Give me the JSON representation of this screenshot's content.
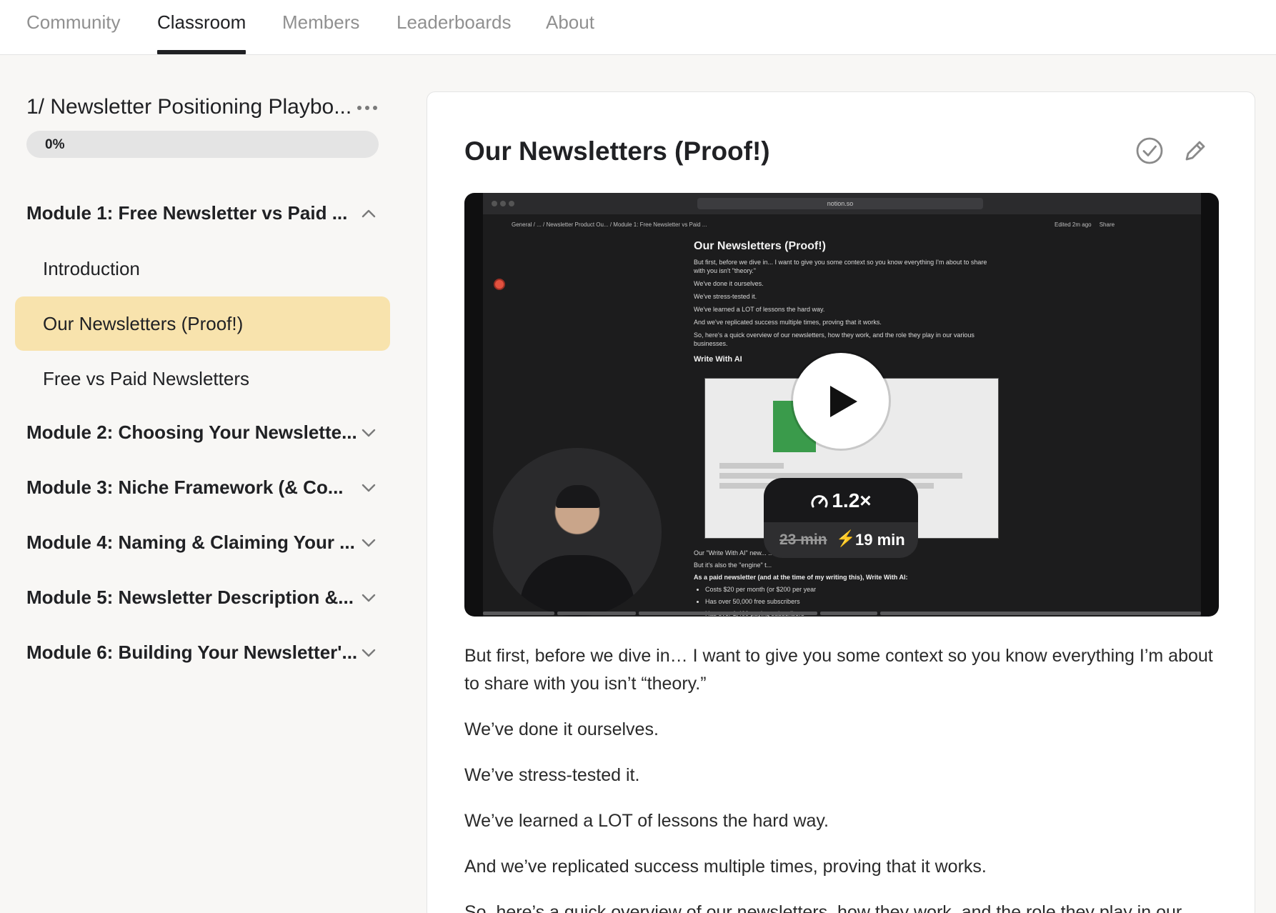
{
  "nav": {
    "tabs": [
      {
        "label": "Community",
        "active": false
      },
      {
        "label": "Classroom",
        "active": true
      },
      {
        "label": "Members",
        "active": false
      },
      {
        "label": "Leaderboards",
        "active": false
      },
      {
        "label": "About",
        "active": false
      }
    ]
  },
  "sidebar": {
    "course_title": "1/ Newsletter Positioning Playbo...",
    "progress": {
      "label": "0%",
      "value": 0
    },
    "modules": [
      {
        "label": "Module 1: Free Newsletter vs Paid ...",
        "expanded": true
      },
      {
        "label": "Module 2: Choosing Your Newslette...",
        "expanded": false
      },
      {
        "label": "Module 3: Niche Framework (& Co...",
        "expanded": false
      },
      {
        "label": "Module 4: Naming & Claiming Your ...",
        "expanded": false
      },
      {
        "label": "Module 5: Newsletter Description &...",
        "expanded": false
      },
      {
        "label": "Module 6: Building Your Newsletter'...",
        "expanded": false
      }
    ],
    "lessons": [
      {
        "label": "Introduction",
        "active": false
      },
      {
        "label": "Our Newsletters (Proof!)",
        "active": true
      },
      {
        "label": "Free vs Paid Newsletters",
        "active": false
      }
    ]
  },
  "lesson": {
    "title": "Our Newsletters (Proof!)",
    "video": {
      "url": "notion.so",
      "breadcrumbs": "General / ... / Newsletter Product Ou... / Module 1: Free Newsletter vs Paid ...",
      "edited": "Edited 2m ago",
      "share": "Share",
      "doc_title": "Our Newsletters (Proof!)",
      "doc_lines": [
        "But first, before we dive in... I want to give you some context so you know everything I'm about to share with you isn't \"theory.\"",
        "We've done it ourselves.",
        "We've stress-tested it.",
        "We've learned a LOT of lessons the hard way.",
        "And we've replicated success multiple times, proving that it works.",
        "So, here's a quick overview of our newsletters, how they work, and the role they play in our various businesses."
      ],
      "doc_subheading": "Write With AI",
      "below_lines": [
        "Our \"Write With AI\" new...                                                                   ...-and-of-itself.",
        "But it's also the \"engine\" t..."
      ],
      "below_bold": "As a paid newsletter (and at the time of my writing this), Write With AI:",
      "bullets": [
        "Costs $20 per month (or $200 per year",
        "Has over 50,000 free subscribers",
        "Has over 1,400 paying subscribers"
      ],
      "speed": "1.2×",
      "duration_original": "23 min",
      "duration_new": "19 min"
    },
    "paragraphs": [
      "But first, before we dive in… I want to give you some context so you know everything I’m about to share with you isn’t “theory.”",
      "We’ve done it ourselves.",
      "We’ve stress-tested it.",
      "We’ve learned a LOT of lessons the hard way.",
      "And we’ve replicated success multiple times, proving that it works.",
      "So, here’s a quick overview of our newsletters, how they work, and the role they play in our"
    ]
  },
  "colors": {
    "accent_active_lesson": "#f8e3ad",
    "nav_active": "#202124",
    "nav_inactive": "#909090"
  }
}
